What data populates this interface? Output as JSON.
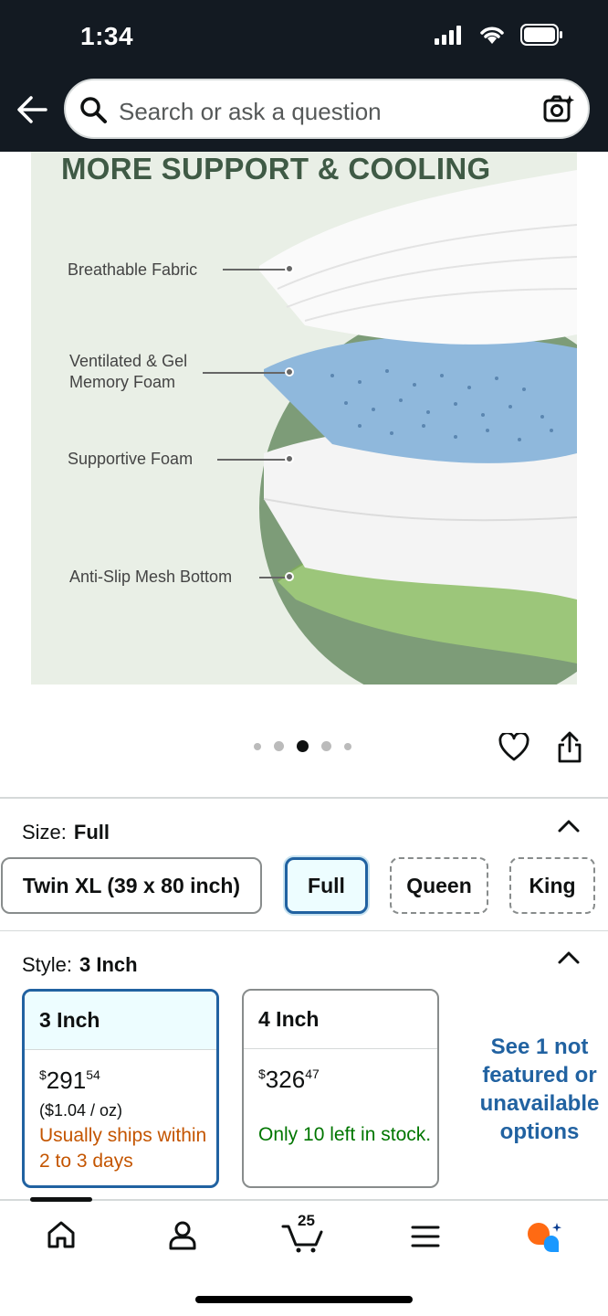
{
  "status_bar": {
    "time": "1:34"
  },
  "search": {
    "placeholder": "Search or ask a question"
  },
  "product_image": {
    "title": "MORE SUPPORT & COOLING",
    "layers": [
      {
        "label": "Breathable Fabric"
      },
      {
        "label": "Ventilated & Gel\nMemory Foam"
      },
      {
        "label": "Supportive Foam"
      },
      {
        "label": "Anti-Slip Mesh Bottom"
      }
    ]
  },
  "carousel": {
    "total": 5,
    "active_index": 2
  },
  "size": {
    "label": "Size:",
    "selected": "Full",
    "options": [
      "Twin XL (39 x 80 inch)",
      "Full",
      "Queen",
      "King"
    ]
  },
  "style": {
    "label": "Style:",
    "selected": "3 Inch",
    "options": [
      {
        "name": "3 Inch",
        "price_symbol": "$",
        "price_whole": "291",
        "price_fraction": "54",
        "unit_price": "($1.04 / oz)",
        "availability": "Usually ships within 2 to 3 days"
      },
      {
        "name": "4 Inch",
        "price_symbol": "$",
        "price_whole": "326",
        "price_fraction": "47",
        "availability": "Only 10 left in stock."
      }
    ],
    "see_more": "See 1 not featured or unavailable options"
  },
  "bottom_nav": {
    "cart_count": "25"
  },
  "colors": {
    "header_bg": "#131a22",
    "link_blue": "#2162a1",
    "ship_orange": "#c45500",
    "stock_green": "#007600",
    "selected_bg": "#edfdff"
  },
  "icons": [
    "back-arrow-icon",
    "search-icon",
    "camera-search-icon",
    "heart-icon",
    "share-icon",
    "chevron-up-icon",
    "home-icon",
    "account-icon",
    "cart-icon",
    "menu-icon",
    "rufus-icon"
  ]
}
